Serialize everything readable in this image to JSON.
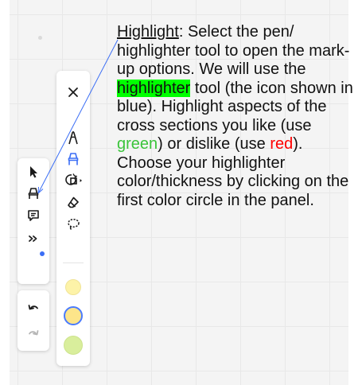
{
  "annotation": {
    "title": "Highlight",
    "t1": ": Select the pen/ highlighter tool to open the mark-up options. We will use the ",
    "highlighter_word": "highlighter",
    "t2": " tool (the icon shown in blue). Highlight aspects of the cross sections you like (use ",
    "green_word": "green",
    "t3": ") or dislike (use ",
    "red_word": "red",
    "t4": "). Choose your highlighter color/thickness by clicking on the first color circle in the panel."
  },
  "left_toolbar": {
    "tools": [
      {
        "name": "select-tool",
        "icon": "cursor-arrow-icon"
      },
      {
        "name": "pen-tool",
        "icon": "highlighter-pen-icon"
      },
      {
        "name": "comment-tool",
        "icon": "comment-icon"
      },
      {
        "name": "more-tools",
        "icon": "double-chevron-right-icon",
        "has_notification_dot": true
      }
    ],
    "history": [
      {
        "name": "undo",
        "icon": "undo-icon",
        "enabled": true
      },
      {
        "name": "redo",
        "icon": "redo-icon",
        "enabled": false
      }
    ]
  },
  "markup_panel": {
    "tools": [
      {
        "name": "close",
        "icon": "close-icon"
      },
      {
        "name": "pen",
        "icon": "pen-icon"
      },
      {
        "name": "highlighter",
        "icon": "highlighter-icon",
        "active": true
      },
      {
        "name": "shape-stamp",
        "icon": "shapes-icon",
        "has_submenu": true
      },
      {
        "name": "eraser",
        "icon": "eraser-icon"
      },
      {
        "name": "lasso",
        "icon": "lasso-icon"
      }
    ],
    "colors": [
      {
        "name": "light-yellow",
        "fill": "#fdf3a8",
        "stroke": "#f0e497",
        "selected": false
      },
      {
        "name": "yellow",
        "fill": "#fde58a",
        "stroke": "#4a7bff",
        "selected": true
      },
      {
        "name": "light-green",
        "fill": "#d9ee9c",
        "stroke": "#cde38d",
        "selected": false
      }
    ]
  },
  "colors": {
    "accent_blue": "#3b6ef5",
    "notification_dot": "#3b6ef5",
    "highlight_green": "#00ff00",
    "text_green": "#3ac43a",
    "text_red": "#ff0000"
  }
}
